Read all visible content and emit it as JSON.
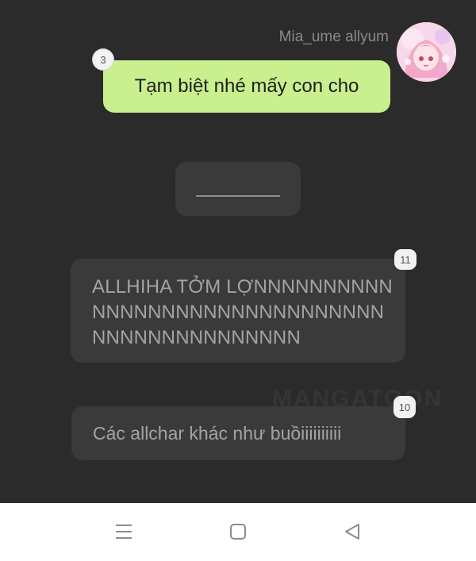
{
  "conversation": {
    "sender_name": "Mia_ume allyum",
    "messages": [
      {
        "text": "Tạm biệt nhé mấy con cho",
        "badge": "3"
      },
      {
        "text": "ALLHIHA TỞM LỢNNNNNNNNNNNNNNNNNNNNNNNNNNNNNNNNNNNNNNNNNNNNNN",
        "badge": "11"
      },
      {
        "text": "Các allchar khác như buồiiiiiiiiii",
        "badge": "10"
      }
    ]
  },
  "watermark": "MANGATOON",
  "icons": {
    "avatar": "anime-avatar",
    "nav_menu": "menu-lines-icon",
    "nav_home": "home-square-icon",
    "nav_back": "back-triangle-icon"
  },
  "colors": {
    "background": "#2b2b2b",
    "own_bubble": "#c9ef8e",
    "other_bubble": "#3a3a3a",
    "navbar": "#ffffff"
  }
}
